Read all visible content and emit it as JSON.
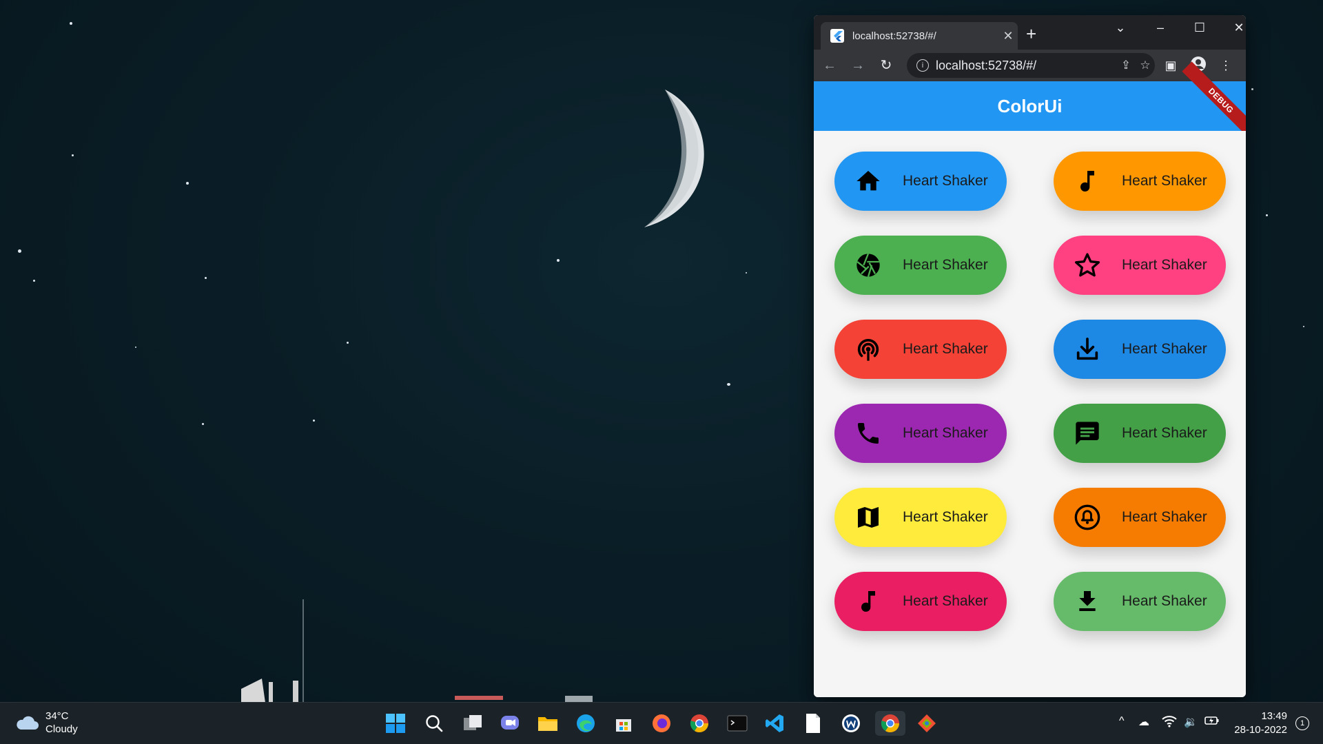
{
  "browser": {
    "tab_title": "localhost:52738/#/",
    "tab_close": "✕",
    "new_tab": "+",
    "url": "localhost:52738/#/"
  },
  "app": {
    "title": "ColorUi",
    "debug_banner": "DEBUG",
    "buttons": [
      {
        "label": "Heart Shaker",
        "color": "#2196f3",
        "icon": "home-icon"
      },
      {
        "label": "Heart Shaker",
        "color": "#ff9800",
        "icon": "music-note-icon"
      },
      {
        "label": "Heart Shaker",
        "color": "#4caf50",
        "icon": "camera-aperture-icon"
      },
      {
        "label": "Heart Shaker",
        "color": "#ff4081",
        "icon": "star-outline-icon"
      },
      {
        "label": "Heart Shaker",
        "color": "#f44336",
        "icon": "podcasts-icon"
      },
      {
        "label": "Heart Shaker",
        "color": "#1e88e5",
        "icon": "download-icon"
      },
      {
        "label": "Heart Shaker",
        "color": "#9c27b0",
        "icon": "phone-icon"
      },
      {
        "label": "Heart Shaker",
        "color": "#43a047",
        "icon": "message-icon"
      },
      {
        "label": "Heart Shaker",
        "color": "#ffeb3b",
        "icon": "map-icon"
      },
      {
        "label": "Heart Shaker",
        "color": "#f57c00",
        "icon": "notification-bell-icon"
      },
      {
        "label": "Heart Shaker",
        "color": "#e91e63",
        "icon": "music-note-icon"
      },
      {
        "label": "Heart Shaker",
        "color": "#66bb6a",
        "icon": "file-download-icon"
      }
    ]
  },
  "taskbar": {
    "weather_temp": "34°C",
    "weather_desc": "Cloudy",
    "time": "13:49",
    "date": "28-10-2022",
    "notification_count": "1"
  }
}
